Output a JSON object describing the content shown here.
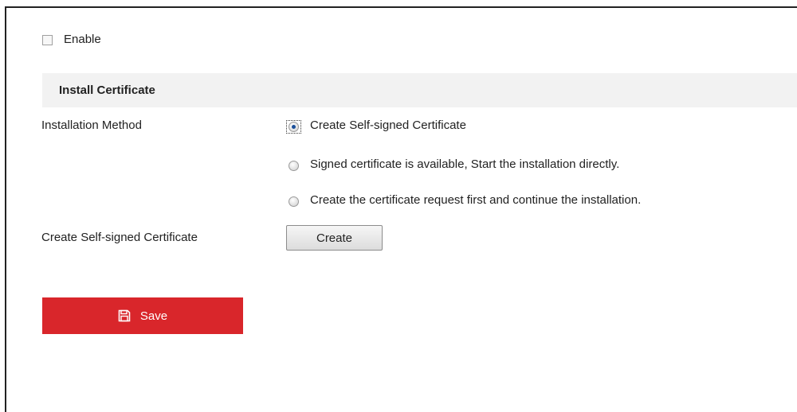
{
  "enable": {
    "label": "Enable",
    "checked": false
  },
  "section": {
    "title": "Install Certificate"
  },
  "installation": {
    "label": "Installation Method",
    "options": [
      {
        "label": "Create Self-signed Certificate",
        "selected": true
      },
      {
        "label": "Signed certificate is available, Start the installation directly.",
        "selected": false
      },
      {
        "label": "Create the certificate request first and continue the installation.",
        "selected": false
      }
    ]
  },
  "self_signed": {
    "label": "Create Self-signed Certificate",
    "button_label": "Create"
  },
  "save": {
    "label": "Save",
    "icon": "save-icon"
  },
  "colors": {
    "save_button": "#d9262b",
    "section_bg": "#f2f2f2",
    "radio_dot": "#1a4f9a"
  }
}
